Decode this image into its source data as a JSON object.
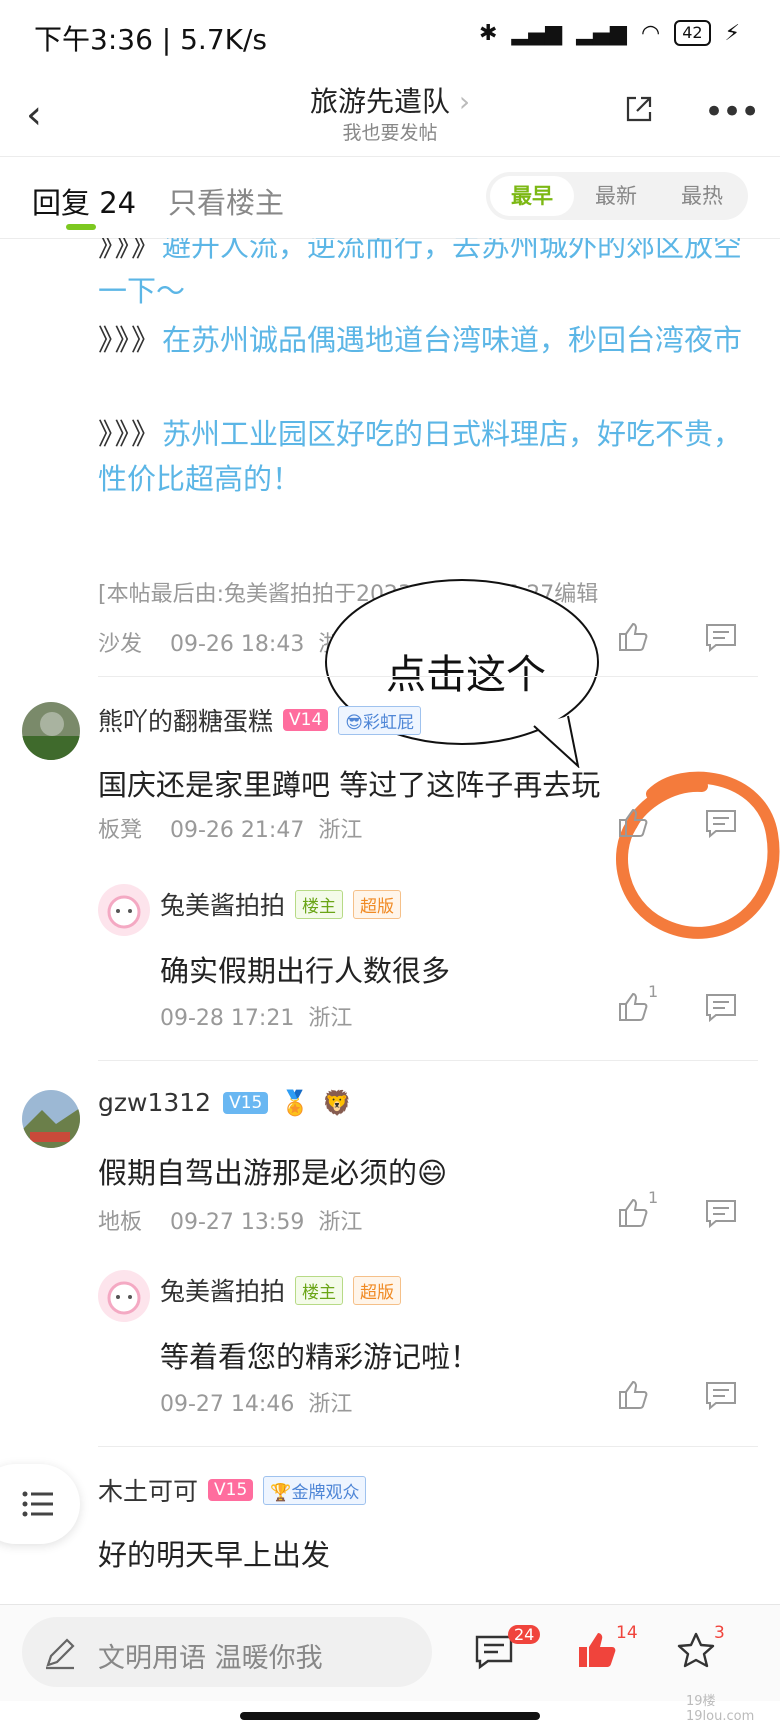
{
  "status_bar": {
    "time": "下午3:36 | 5.7K/s",
    "battery": "42"
  },
  "nav": {
    "title": "旅游先遣队",
    "subtitle": "我也要发帖"
  },
  "tabs": {
    "reply_label": "回复",
    "reply_count": "24",
    "owner_only": "只看楼主"
  },
  "sort": [
    "最早",
    "最新",
    "最热"
  ],
  "post": {
    "lines": [
      {
        "marker": "》》》",
        "text": "避开人流，逆流而行，去苏州城外的郊区放空一下～"
      },
      {
        "marker": "》》》",
        "text": "在苏州诚品偶遇地道台湾味道，秒回台湾夜市"
      },
      {
        "marker": "》》》",
        "text": "苏州工业园区好吃的日式料理店，好吃不贵，性价比超高的！"
      }
    ],
    "edit_note": "[本帖最后由:兔美酱拍拍于2023-10-11 16:27编辑",
    "floor": "沙发",
    "time": "09-26 18:43",
    "location": "浙江"
  },
  "annotation": {
    "bubble_text": "点击这个"
  },
  "comments": [
    {
      "user": "熊吖的翻糖蛋糕",
      "level": "V14",
      "badge": "彩虹屁",
      "text": "国庆还是家里蹲吧 等过了这阵子再去玩",
      "floor": "板凳",
      "time": "09-26 21:47",
      "location": "浙江",
      "likes": "",
      "reply": {
        "user": "兔美酱拍拍",
        "tag1": "楼主",
        "tag2": "超版",
        "text": "确实假期出行人数很多",
        "time": "09-28 17:21",
        "location": "浙江",
        "likes": "1"
      }
    },
    {
      "user": "gzw1312",
      "level": "V15",
      "badge": "",
      "text": "假期自驾出游那是必须的😄",
      "floor": "地板",
      "time": "09-27 13:59",
      "location": "浙江",
      "likes": "1",
      "reply": {
        "user": "兔美酱拍拍",
        "tag1": "楼主",
        "tag2": "超版",
        "text": "等着看您的精彩游记啦！",
        "time": "09-27 14:46",
        "location": "浙江",
        "likes": ""
      }
    },
    {
      "user": "木土可可",
      "level": "V15",
      "badge": "金牌观众",
      "text": "好的明天早上出发"
    }
  ],
  "bottom": {
    "placeholder": "文明用语 温暖你我",
    "comment_count": "24",
    "like_count": "14",
    "fav_count": "3"
  },
  "watermark": "19楼 19lou.com"
}
